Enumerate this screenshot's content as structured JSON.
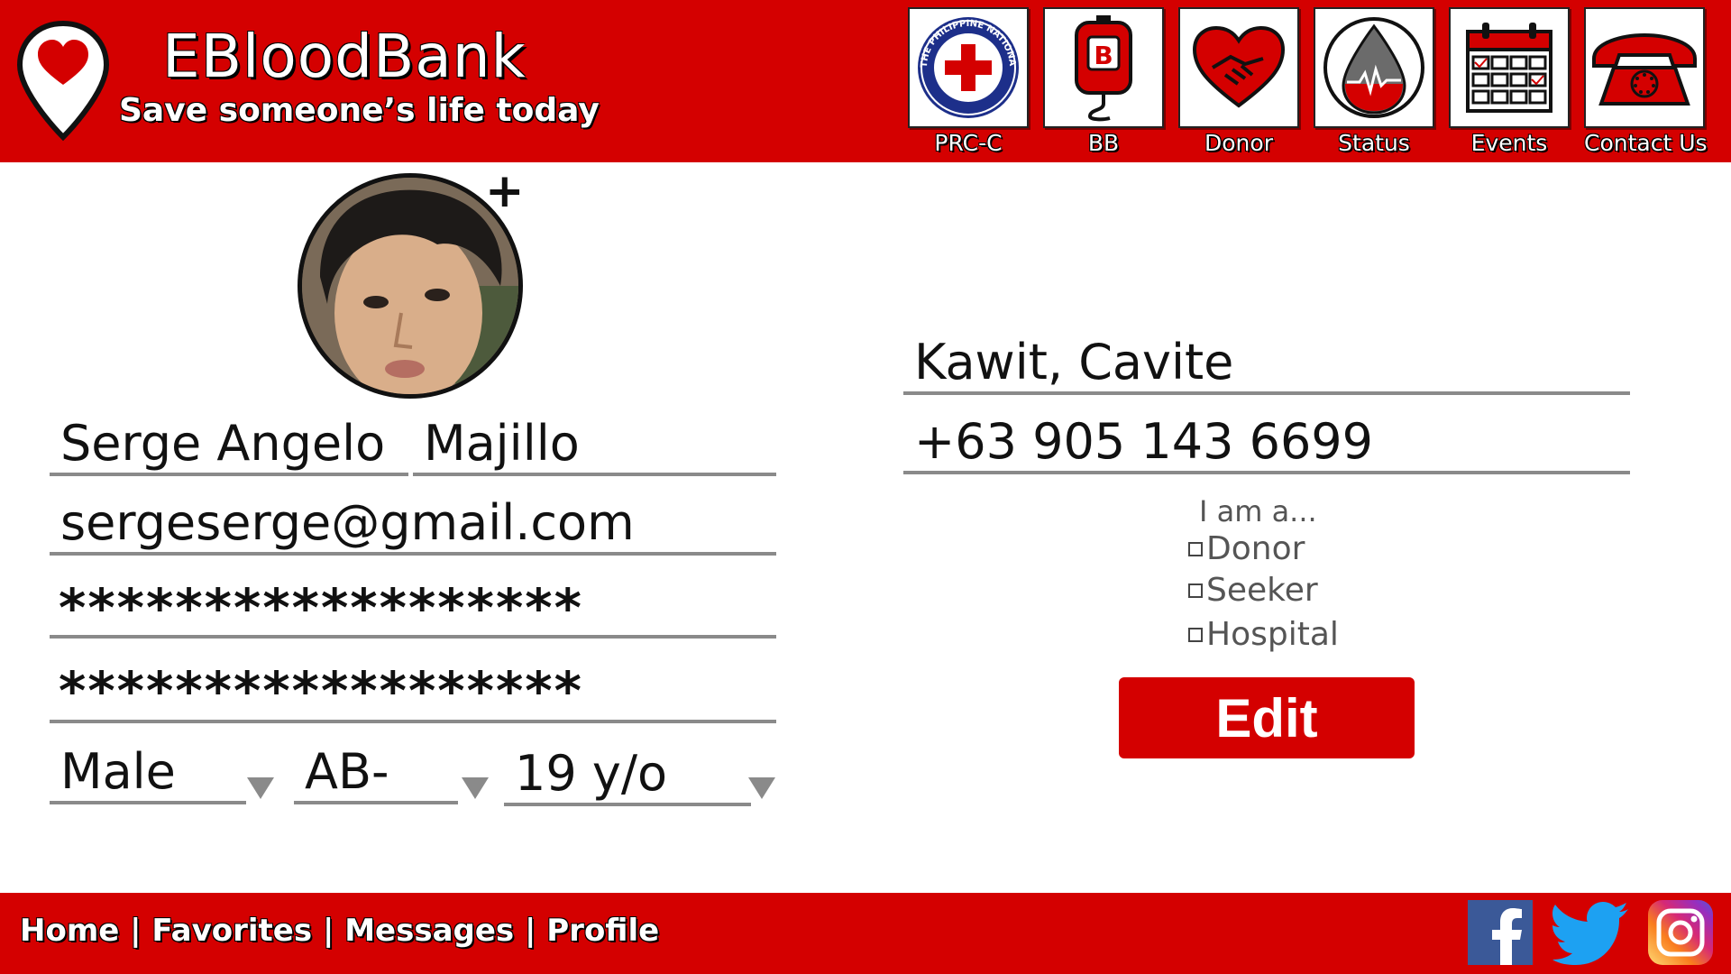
{
  "header": {
    "title": "EBloodBank",
    "tagline": "Save someone’s life today",
    "nav": [
      {
        "label": "PRC-C",
        "icon": "red-cross-icon"
      },
      {
        "label": "BB",
        "icon": "blood-bag-icon"
      },
      {
        "label": "Donor",
        "icon": "handshake-heart-icon"
      },
      {
        "label": "Status",
        "icon": "blood-drop-icon"
      },
      {
        "label": "Events",
        "icon": "calendar-icon"
      },
      {
        "label": "Contact Us",
        "icon": "telephone-icon"
      }
    ],
    "seal_text": "THE PHILIPPINE NATIONAL RED CROSS",
    "bag_letter": "B"
  },
  "profile": {
    "avatar_add": "+",
    "first_name": "Serge Angelo",
    "last_name": "Majillo",
    "email": "sergeserge@gmail.com",
    "password": "******************",
    "confirm_password": "******************",
    "gender": "Male",
    "blood_type": "AB-",
    "age": "19 y/o",
    "location": "Kawit, Cavite",
    "phone": "+63 905 143 6699"
  },
  "role": {
    "title": "I am a...",
    "options": [
      "Donor",
      "Seeker",
      "Hospital"
    ]
  },
  "edit_label": "Edit",
  "footer": {
    "links": [
      "Home",
      "Favorites",
      "Messages",
      "Profile"
    ],
    "separator": "|",
    "social": [
      "facebook-icon",
      "twitter-icon",
      "instagram-icon"
    ]
  },
  "colors": {
    "brand": "#d40000",
    "field_line": "#8a8a8a"
  }
}
